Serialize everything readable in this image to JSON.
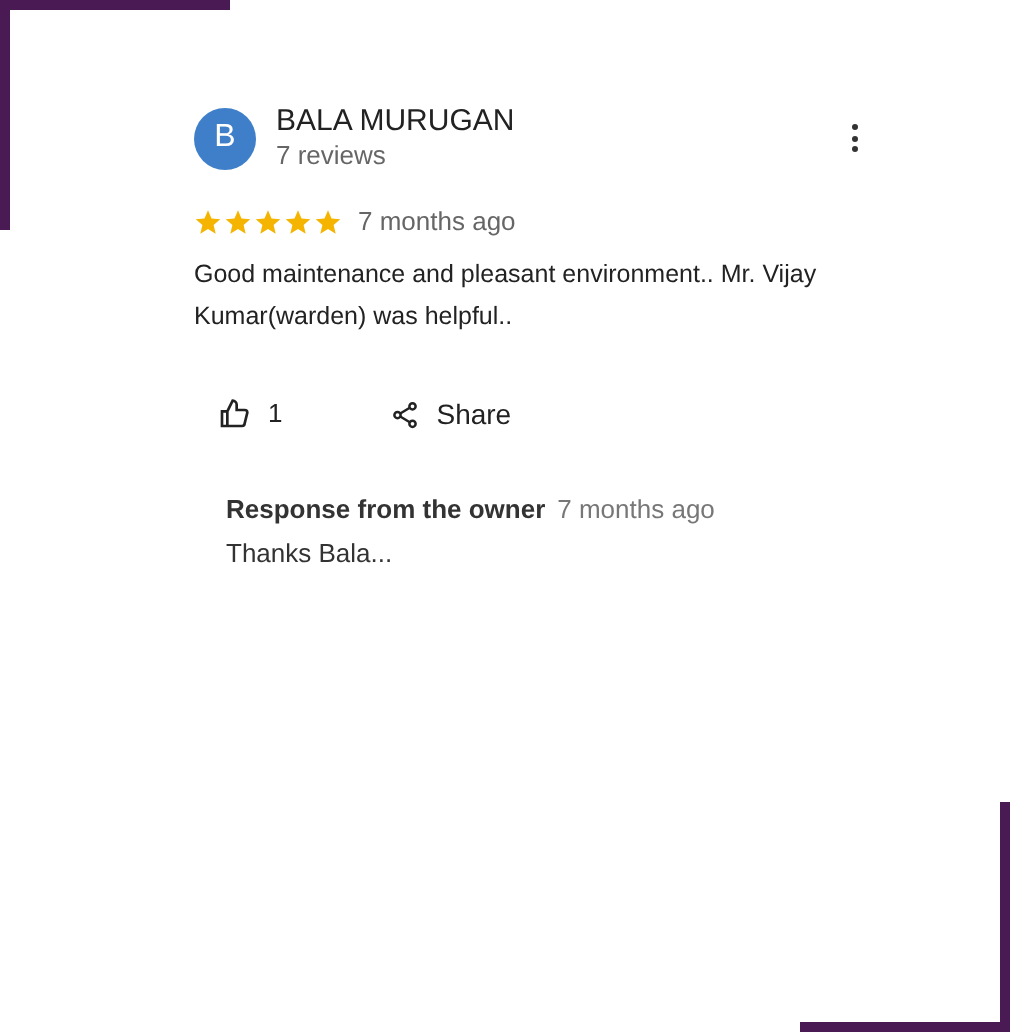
{
  "review": {
    "avatar_initial": "B",
    "reviewer": "BALA MURUGAN",
    "review_count": "7 reviews",
    "stars": 5,
    "time": "7 months ago",
    "text": "Good maintenance and pleasant environment.. Mr. Vijay Kumar(warden) was helpful..",
    "likes": "1",
    "share": "Share"
  },
  "response": {
    "label": "Response from the owner",
    "time": "7 months ago",
    "text": "Thanks Bala..."
  }
}
